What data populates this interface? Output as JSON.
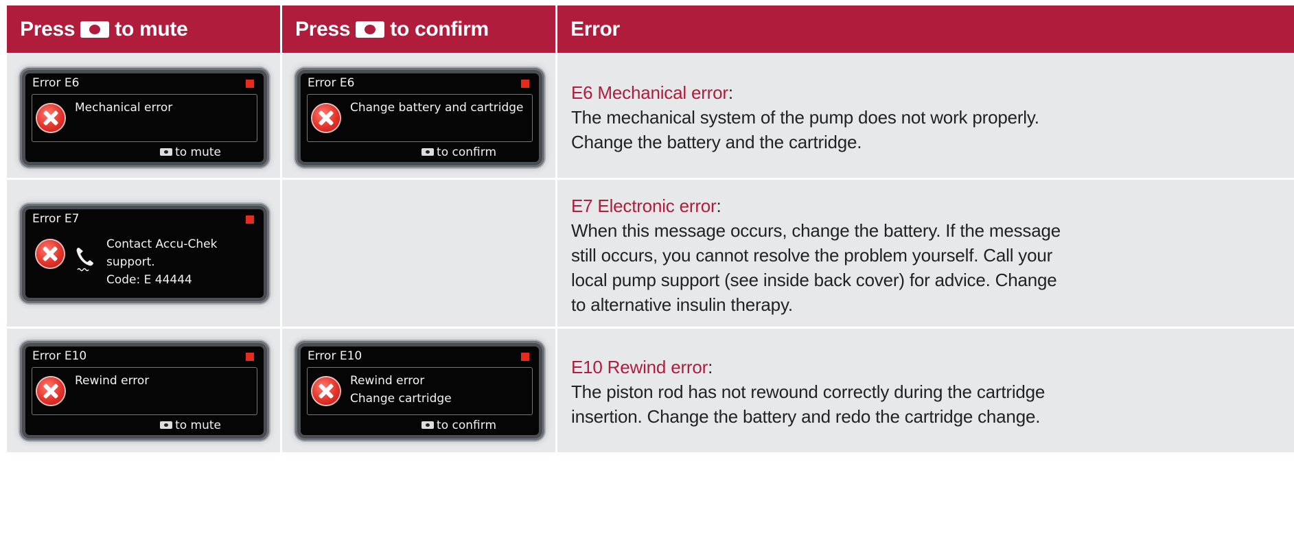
{
  "header": {
    "col1_before": "Press",
    "col1_after": "to mute",
    "col2_before": "Press",
    "col2_after": "to confirm",
    "col3": "Error"
  },
  "icons": {
    "button": "round-button-icon",
    "error": "error-x-icon",
    "phone": "phone-icon",
    "indicator": "red-indicator-icon"
  },
  "colors": {
    "header_bg": "#b01c3c",
    "cell_bg": "#e7e8ea",
    "title_red": "#b01c3c"
  },
  "rows": [
    {
      "mute_screen": {
        "title": "Error E6",
        "message": [
          "Mechanical error"
        ],
        "footer": "to mute"
      },
      "confirm_screen": {
        "title": "Error E6",
        "message": [
          "Change battery and cartridge"
        ],
        "footer": "to confirm"
      },
      "error_title": "E6 Mechanical error",
      "error_text": [
        "The mechanical system of the pump does not work properly.",
        "Change the battery and the cartridge."
      ]
    },
    {
      "mute_screen": {
        "title": "Error E7",
        "message": [
          "Contact Accu-Chek",
          "support.",
          "Code: E 44444"
        ]
      },
      "error_title": "E7 Electronic error",
      "error_text": [
        "When this message occurs, change the battery. If the message",
        "still occurs, you cannot resolve the problem yourself. Call your",
        "local pump support (see inside back cover) for advice. Change",
        "to alternative insulin therapy."
      ]
    },
    {
      "mute_screen": {
        "title": "Error E10",
        "message": [
          "Rewind error"
        ],
        "footer": "to mute"
      },
      "confirm_screen": {
        "title": "Error E10",
        "message": [
          "Rewind error",
          "Change cartridge"
        ],
        "footer": "to confirm"
      },
      "error_title": "E10 Rewind error",
      "error_text": [
        "The piston rod has not rewound correctly during the cartridge",
        "insertion. Change the battery and redo the cartridge change."
      ]
    }
  ]
}
